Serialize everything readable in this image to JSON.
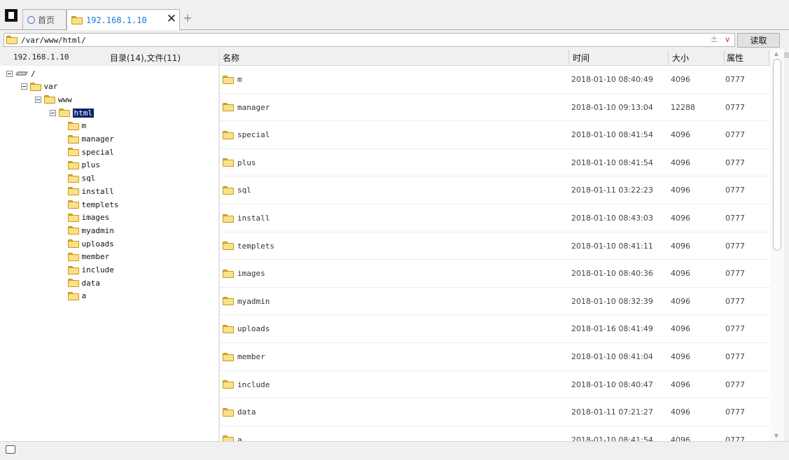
{
  "tabs": {
    "home_label": "首页",
    "server_label": "192.168.1.10",
    "close_glyph": "✕",
    "add_glyph": "+"
  },
  "pathbar": {
    "path": "/var/www/html/",
    "plusminus_glyph": "±",
    "dropdown_glyph": "∨",
    "read_button": "读取"
  },
  "left_panel": {
    "host": "192.168.1.10",
    "summary": "目录(14),文件(11)",
    "tree": [
      {
        "label": "/",
        "depth": 0,
        "expanded": true,
        "icon": "drive"
      },
      {
        "label": "var",
        "depth": 1,
        "expanded": true,
        "icon": "folder"
      },
      {
        "label": "www",
        "depth": 2,
        "expanded": true,
        "icon": "folder"
      },
      {
        "label": "html",
        "depth": 3,
        "expanded": true,
        "icon": "folder-open",
        "selected": true
      },
      {
        "label": "m",
        "depth": 4,
        "icon": "folder"
      },
      {
        "label": "manager",
        "depth": 4,
        "icon": "folder"
      },
      {
        "label": "special",
        "depth": 4,
        "icon": "folder"
      },
      {
        "label": "plus",
        "depth": 4,
        "icon": "folder"
      },
      {
        "label": "sql",
        "depth": 4,
        "icon": "folder"
      },
      {
        "label": "install",
        "depth": 4,
        "icon": "folder"
      },
      {
        "label": "templets",
        "depth": 4,
        "icon": "folder"
      },
      {
        "label": "images",
        "depth": 4,
        "icon": "folder"
      },
      {
        "label": "myadmin",
        "depth": 4,
        "icon": "folder"
      },
      {
        "label": "uploads",
        "depth": 4,
        "icon": "folder"
      },
      {
        "label": "member",
        "depth": 4,
        "icon": "folder"
      },
      {
        "label": "include",
        "depth": 4,
        "icon": "folder"
      },
      {
        "label": "data",
        "depth": 4,
        "icon": "folder"
      },
      {
        "label": "a",
        "depth": 4,
        "icon": "folder"
      }
    ]
  },
  "grid": {
    "columns": {
      "name": "名称",
      "time": "时间",
      "size": "大小",
      "attr": "属性"
    },
    "rows": [
      {
        "name": "m",
        "time": "2018-01-10 08:40:49",
        "size": "4096",
        "attr": "0777"
      },
      {
        "name": "manager",
        "time": "2018-01-10 09:13:04",
        "size": "12288",
        "attr": "0777"
      },
      {
        "name": "special",
        "time": "2018-01-10 08:41:54",
        "size": "4096",
        "attr": "0777"
      },
      {
        "name": "plus",
        "time": "2018-01-10 08:41:54",
        "size": "4096",
        "attr": "0777"
      },
      {
        "name": "sql",
        "time": "2018-01-11 03:22:23",
        "size": "4096",
        "attr": "0777"
      },
      {
        "name": "install",
        "time": "2018-01-10 08:43:03",
        "size": "4096",
        "attr": "0777"
      },
      {
        "name": "templets",
        "time": "2018-01-10 08:41:11",
        "size": "4096",
        "attr": "0777"
      },
      {
        "name": "images",
        "time": "2018-01-10 08:40:36",
        "size": "4096",
        "attr": "0777"
      },
      {
        "name": "myadmin",
        "time": "2018-01-10 08:32:39",
        "size": "4096",
        "attr": "0777"
      },
      {
        "name": "uploads",
        "time": "2018-01-16 08:41:49",
        "size": "4096",
        "attr": "0777"
      },
      {
        "name": "member",
        "time": "2018-01-10 08:41:04",
        "size": "4096",
        "attr": "0777"
      },
      {
        "name": "include",
        "time": "2018-01-10 08:40:47",
        "size": "4096",
        "attr": "0777"
      },
      {
        "name": "data",
        "time": "2018-01-11 07:21:27",
        "size": "4096",
        "attr": "0777"
      },
      {
        "name": "a",
        "time": "2018-01-10 08:41:54",
        "size": "4096",
        "attr": "0777"
      }
    ]
  },
  "colors": {
    "accent": "#1a7ad6",
    "selection": "#0a246a",
    "folder": "#fbe08a"
  }
}
